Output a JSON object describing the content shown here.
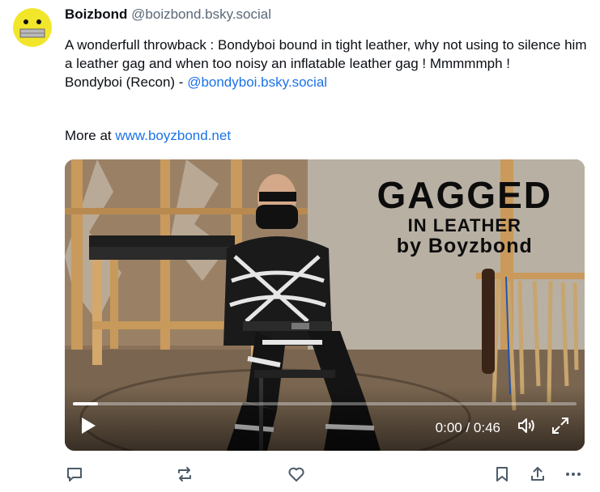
{
  "author": {
    "display_name": "Boizbond",
    "handle": "@boizbond.bsky.social"
  },
  "post": {
    "text_line1": "A wonderfull throwback : Bondyboi bound in tight leather,  why not using to silence him a leather gag and when too noisy an inflatable leather gag ! Mmmmmph !",
    "credit_prefix": "Bondyboi (Recon)  -  ",
    "credit_link": "@bondyboi.bsky.social",
    "more_prefix": "More at ",
    "more_link": "www.boyzbond.net"
  },
  "video": {
    "overlay_line1": "GAGGED",
    "overlay_line2": "IN LEATHER",
    "overlay_line3": "by Boyzbond",
    "time": "0:00 / 0:46",
    "progress": 0.05
  },
  "actions": {
    "icons": [
      "reply-icon",
      "repost-icon",
      "like-icon",
      "bookmark-icon",
      "share-icon",
      "more-icon"
    ]
  },
  "colors": {
    "link": "#1a73e8",
    "handle": "#5a6978",
    "icon": "#4d5b6a"
  }
}
